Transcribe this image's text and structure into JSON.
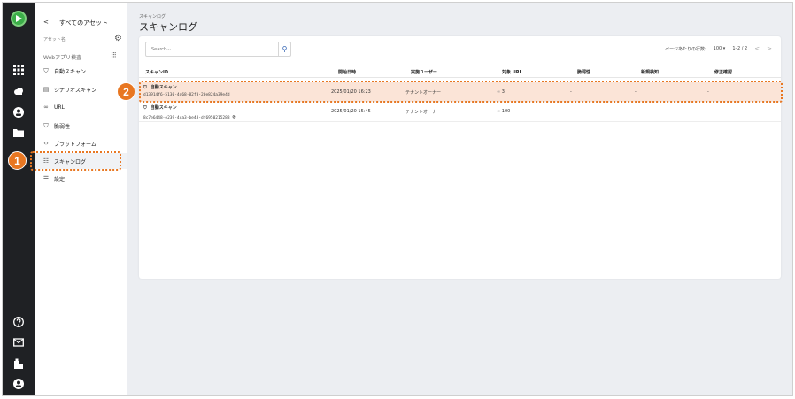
{
  "sidebar": {
    "back_label": "すべてのアセット",
    "asset_name": "アセット名",
    "section_label": "Webアプリ検査",
    "items": [
      {
        "label": "自動スキャン",
        "icon": "shield-icon"
      },
      {
        "label": "シナリオスキャン",
        "icon": "scenario-icon"
      },
      {
        "label": "URL",
        "icon": "link-icon"
      },
      {
        "label": "脆弱性",
        "icon": "shield-icon"
      },
      {
        "label": "プラットフォーム",
        "icon": "code-icon"
      },
      {
        "label": "スキャンログ",
        "icon": "log-icon"
      },
      {
        "label": "設定",
        "icon": "settings-icon"
      }
    ]
  },
  "header": {
    "breadcrumb": "スキャンログ",
    "title": "スキャンログ"
  },
  "search": {
    "placeholder": "Search···"
  },
  "pager": {
    "rows_label": "ページあたりの行数:",
    "rows_value": "100",
    "range": "1–2 / 2"
  },
  "table": {
    "columns": [
      "スキャンID",
      "開始日時",
      "実施ユーザー",
      "対象 URL",
      "脆弱性",
      "新規検知",
      "修正確認"
    ],
    "rows": [
      {
        "type": "自動スキャン",
        "id": "d13914f6-5130-4d68-82f3-20e824a39e4d",
        "start": "2025/01/20 16:23",
        "user": "テナントオーナー",
        "urls": "3",
        "vulns": "-",
        "new": "-",
        "fixed": "-"
      },
      {
        "type": "自動スキャン",
        "id": "8c7e6448-e239-4ca3-be48-df6950215288",
        "start": "2025/01/20 15:45",
        "user": "テナントオーナー",
        "urls": "100",
        "vulns": "-",
        "new": "",
        "fixed": ""
      }
    ]
  },
  "callouts": {
    "one": "1",
    "two": "2"
  },
  "colors": {
    "accent": "#e87722",
    "highlight": "#fbe4d7",
    "rail": "#1f2124",
    "brand": "#3cae49"
  }
}
